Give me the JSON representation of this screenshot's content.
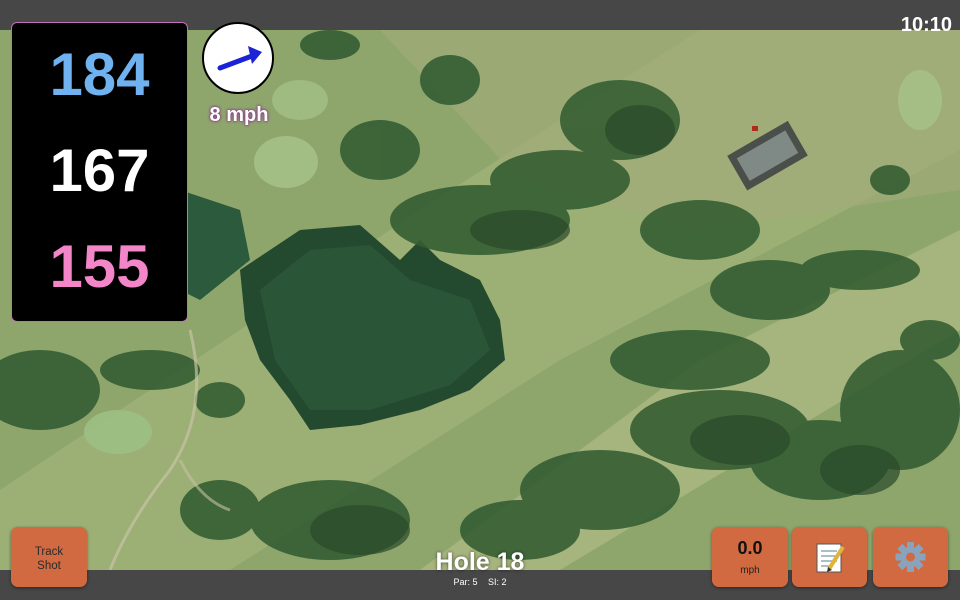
{
  "status_bar": {
    "time": "10:10"
  },
  "distances": {
    "back": "184",
    "middle": "167",
    "front": "155"
  },
  "wind": {
    "speed_label": "8 mph",
    "icon": "arrow-icon"
  },
  "buttons": {
    "track_shot": {
      "line1": "Track",
      "line2": "Shot"
    },
    "speed": {
      "value": "0.0",
      "unit": "mph"
    },
    "notes": {
      "icon": "notepad-icon"
    },
    "settings": {
      "icon": "gear-icon"
    }
  },
  "hole": {
    "title": "Hole 18",
    "par": "Par: 5",
    "si": "SI: 2"
  },
  "colors": {
    "back": "#6fb2ef",
    "middle": "#ffffff",
    "front": "#f386c8",
    "button": "#d16a41",
    "bar": "#474747"
  }
}
